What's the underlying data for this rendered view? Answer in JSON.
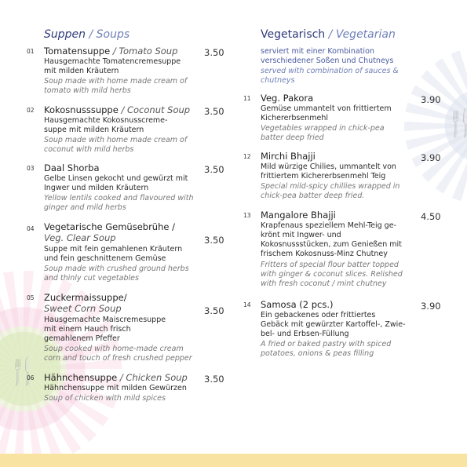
{
  "soups": {
    "title_de": "Suppen",
    "title_sep": "/",
    "title_en": "Soups",
    "items": [
      {
        "num": "01",
        "name_de": "Tomatensuppe",
        "sep": "/",
        "name_en": "Tomato Soup",
        "price": "3.50",
        "desc_de": [
          "Hausgemachte Tomatencremesuppe",
          "mit milden Kräutern"
        ],
        "desc_en": [
          "Soup made with home made cream of",
          "tomato with mild herbs"
        ]
      },
      {
        "num": "02",
        "name_de": "Kokosnusssuppe",
        "sep": "/",
        "name_en": "Coconut Soup",
        "price": "3.50",
        "desc_de": [
          "Hausgemachte Kokosnusscreme-",
          "suppe mit milden Kräutern"
        ],
        "desc_en": [
          "Soup made with home made cream of",
          "coconut with mild herbs"
        ]
      },
      {
        "num": "03",
        "name_de": "Daal Shorba",
        "price": "3.50",
        "desc_de": [
          "Gelbe Linsen gekocht und gewürzt mit",
          "Ingwer und milden Kräutern"
        ],
        "desc_en": [
          "Yellow lentils cooked and flavoured with",
          "ginger and mild herbs"
        ]
      },
      {
        "num": "04",
        "name_de": "Vegetarische Gemüsebrühe /",
        "name_en": "Veg. Clear Soup",
        "price": "3.50",
        "desc_de": [
          "Suppe mit fein gemahlenen Kräutern",
          "und fein geschnittenem Gemüse"
        ],
        "desc_en": [
          "Soup made with crushed ground herbs",
          "and thinly cut vegetables"
        ]
      },
      {
        "num": "05",
        "name_de": "Zuckermaissuppe/",
        "name_en": "Sweet Corn Soup",
        "price": "3.50",
        "desc_de": [
          "Hausgemachte Maiscremesuppe",
          "mit einem Hauch frisch",
          "gemahlenem Pfeffer"
        ],
        "desc_en": [
          "Soup cooked with home-made cream",
          "corn and touch of fresh crushed pepper"
        ]
      },
      {
        "num": "06",
        "name_de": "Hähnchensuppe",
        "sep": "/",
        "name_en": "Chicken Soup",
        "price": "3.50",
        "desc_de": [
          "Hähnchensuppe mit milden Gewürzen"
        ],
        "desc_en": [
          "Soup of chicken with mild spices"
        ]
      }
    ]
  },
  "vegetarian": {
    "title_de": "Vegetarisch",
    "title_sep": "/",
    "title_en": "Vegetarian",
    "intro_de": [
      "serviert mit einer Kombination",
      "verschiedener Soßen und Chutneys"
    ],
    "intro_en": [
      "served with combination of sauces &",
      "chutneys"
    ],
    "items": [
      {
        "num": "11",
        "name_de": "Veg. Pakora",
        "price": "3.90",
        "desc_de": [
          "Gemüse ummantelt von frittiertem",
          "Kichererbsenmehl"
        ],
        "desc_en": [
          "Vegetables wrapped in chick-pea",
          "batter deep fried"
        ]
      },
      {
        "num": "12",
        "name_de": "Mirchi Bhajji",
        "price": "3.90",
        "desc_de": [
          "Mild würzige Chilies, ummantelt von",
          "frittiertem Kichererbsenmehl Teig"
        ],
        "desc_en": [
          "Special mild-spicy chillies wrapped in",
          "chick-pea batter deep fried."
        ]
      },
      {
        "num": "13",
        "name_de": "Mangalore Bhajji",
        "price": "4.50",
        "desc_de": [
          "Krapfenaus speziellem Mehl-Teig ge-",
          "krönt mit Ingwer- und",
          "Kokosnussstücken, zum Genießen mit",
          "frischem Kokosnuss-Minz Chutney"
        ],
        "desc_en": [
          "Fritters of special flour batter topped",
          "with ginger & coconut slices. Relished",
          "with fresh coconut / mint chutney"
        ]
      },
      {
        "num": "14",
        "name_de": "Samosa (2 pcs.)",
        "price": "3.90",
        "desc_de": [
          "Ein gebackenes oder frittiertes",
          "Gebäck mit gewürzter Kartoffel-, Zwie-",
          "bel- und Erbsen-Füllung"
        ],
        "desc_en": [
          "A fried or baked pastry with spiced",
          "potatoes, onions & peas filling"
        ]
      }
    ]
  },
  "colors": {
    "title": "#2f3b7a",
    "title_accent": "#6f7fb8",
    "bottom_bar": "#f9e3a3"
  },
  "icons": [
    "mandala-decoration",
    "fork-knife-icon"
  ]
}
